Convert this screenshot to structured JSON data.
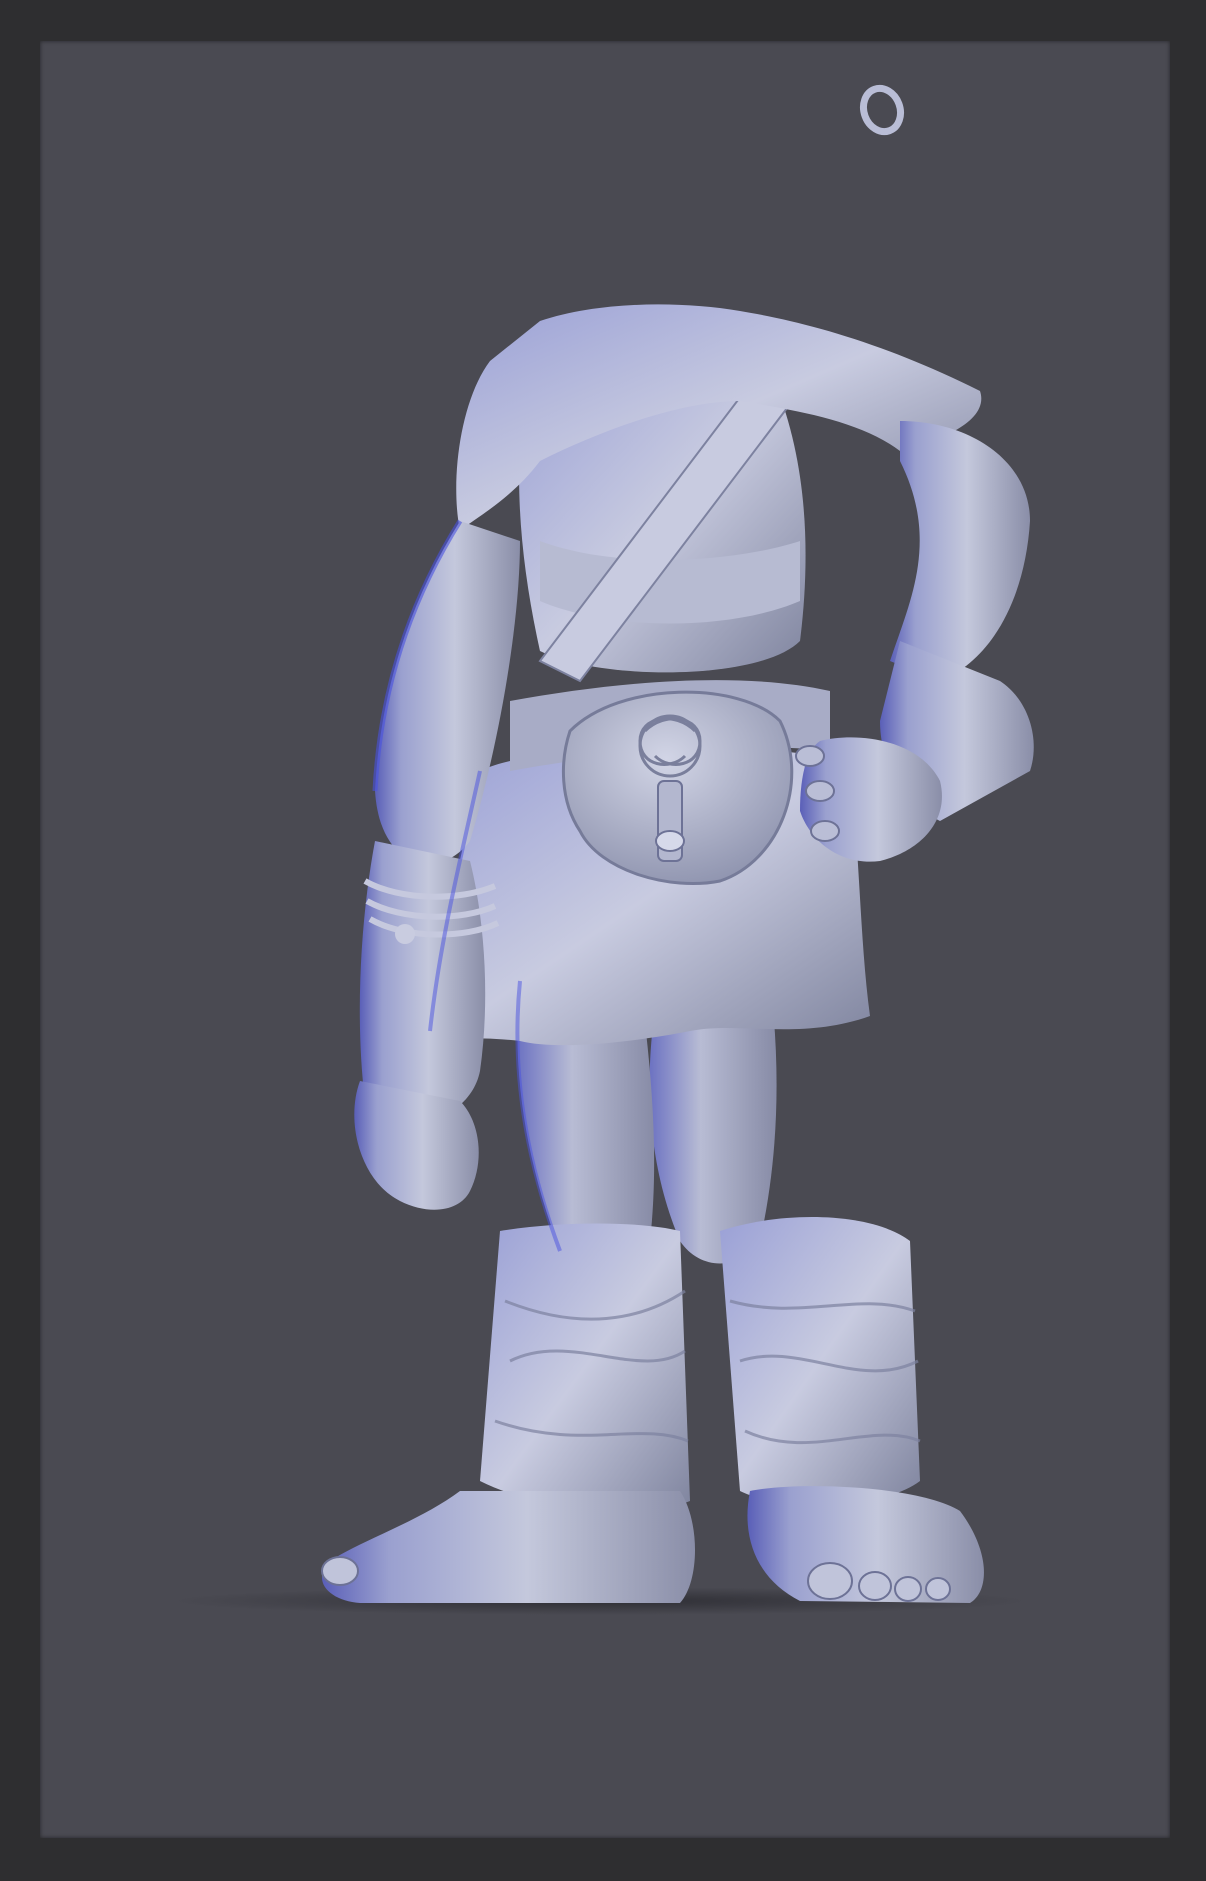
{
  "scene": {
    "description_alt": "",
    "colors": {
      "outer_frame": "#2e2e30",
      "viewport_bg": "#4a4a52",
      "model_base": "#a9aec7",
      "model_highlight": "#d9dcef",
      "model_shadow": "#5a5f88",
      "rim_light": "#4b53d8",
      "ground_shadow": "#2f2f35"
    },
    "subject": "headless-character-sculpt"
  }
}
